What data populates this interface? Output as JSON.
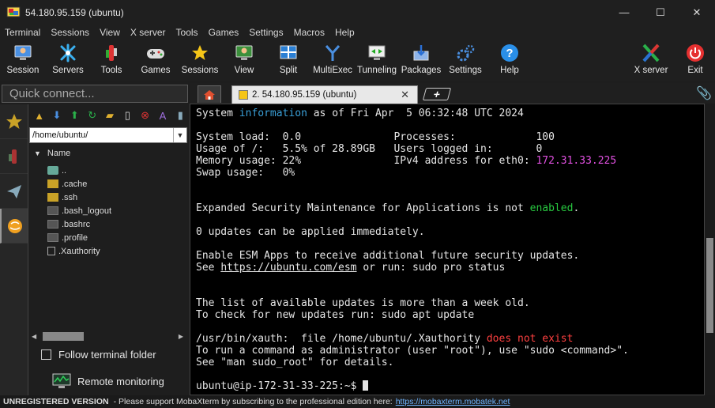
{
  "window": {
    "title": "54.180.95.159 (ubuntu)",
    "minimize": "—",
    "maximize": "☐",
    "close": "✕"
  },
  "menu": [
    "Terminal",
    "Sessions",
    "View",
    "X server",
    "Tools",
    "Games",
    "Settings",
    "Macros",
    "Help"
  ],
  "toolbar": {
    "session": "Session",
    "servers": "Servers",
    "tools": "Tools",
    "games": "Games",
    "sessions": "Sessions",
    "view": "View",
    "split": "Split",
    "multiexec": "MultiExec",
    "tunneling": "Tunneling",
    "packages": "Packages",
    "settings": "Settings",
    "help": "Help",
    "xserver": "X server",
    "exit": "Exit"
  },
  "quick_connect": {
    "placeholder": "Quick connect..."
  },
  "tabs": {
    "active_label": "2. 54.180.95.159 (ubuntu)",
    "close": "✕",
    "add": "+"
  },
  "filepanel": {
    "path": "/home/ubuntu/",
    "column": "Name",
    "items": [
      "..",
      ".cache",
      ".ssh",
      ".bash_logout",
      ".bashrc",
      ".profile",
      ".Xauthority"
    ],
    "follow_label": "Follow terminal folder",
    "remote_label": "Remote monitoring"
  },
  "terminal": {
    "l1a": "System ",
    "l1b": "information",
    "l1c": " as of Fri Apr  5 06:32:48 UTC 2024",
    "l2": "System load:  0.0               Processes:             100",
    "l3": "Usage of /:   5.5% of 28.89GB   Users logged in:       0",
    "l4a": "Memory usage: 22%               IPv4 address for eth0: ",
    "l4b": "172.31.33.225",
    "l5": "Swap usage:   0%",
    "l6a": "Expanded Security Maintenance for Applications is not ",
    "l6b": "enabled",
    "l6c": ".",
    "l7": "0 updates can be applied immediately.",
    "l8": "Enable ESM Apps to receive additional future security updates.",
    "l9a": "See ",
    "l9b": "https://ubuntu.com/esm",
    "l9c": " or run: sudo pro status",
    "l10": "The list of available updates is more than a week old.",
    "l11": "To check for new updates run: sudo apt update",
    "l12a": "/usr/bin/xauth:  file /home/ubuntu/.Xauthority ",
    "l12b": "does not exist",
    "l13": "To run a command as administrator (user \"root\"), use \"sudo <command>\".",
    "l14": "See \"man sudo_root\" for details.",
    "prompt": "ubuntu@ip-172-31-33-225:~$ "
  },
  "statusbar": {
    "unregistered": "UNREGISTERED VERSION",
    "message": "-  Please support MobaXterm by subscribing to the professional edition here:",
    "link": "https://mobaxterm.mobatek.net"
  }
}
